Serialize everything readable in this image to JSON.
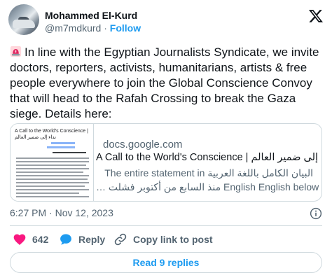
{
  "author": {
    "name": "Mohammed El-Kurd",
    "handle": "@m7mdkurd",
    "separator": " · ",
    "follow_label": "Follow"
  },
  "tweet": {
    "text": "In line with the Egyptian Journalists Syndicate, we invite doctors, reporters, activists, humanitarians, artists & free people everywhere to join the Global Conscience Convoy that will head to the Rafah Crossing to break the Gaza siege. Details here:",
    "emoji_icon": "siren-icon"
  },
  "link_card": {
    "domain": "docs.google.com",
    "title": "A Call to the World's Conscience | نداء إلى ضمير العالم",
    "description_line1": "The entire statement in البيان الكامل باللغة العربية",
    "description_line2": "… منذ السابع من أكتوبر فشلت English English below",
    "thumbnail_title": "A Call to the World's Conscience | نداء إلى ضمير العالم"
  },
  "timestamp": "6:27 PM · Nov 12, 2023",
  "actions": {
    "likes": "642",
    "reply_label": "Reply",
    "copy_label": "Copy link to post"
  },
  "read_replies_label": "Read 9 replies",
  "colors": {
    "accent": "#1d9bf0",
    "like": "#f91880",
    "text": "#0f1419",
    "muted": "#536471",
    "border": "#cfd9de"
  }
}
